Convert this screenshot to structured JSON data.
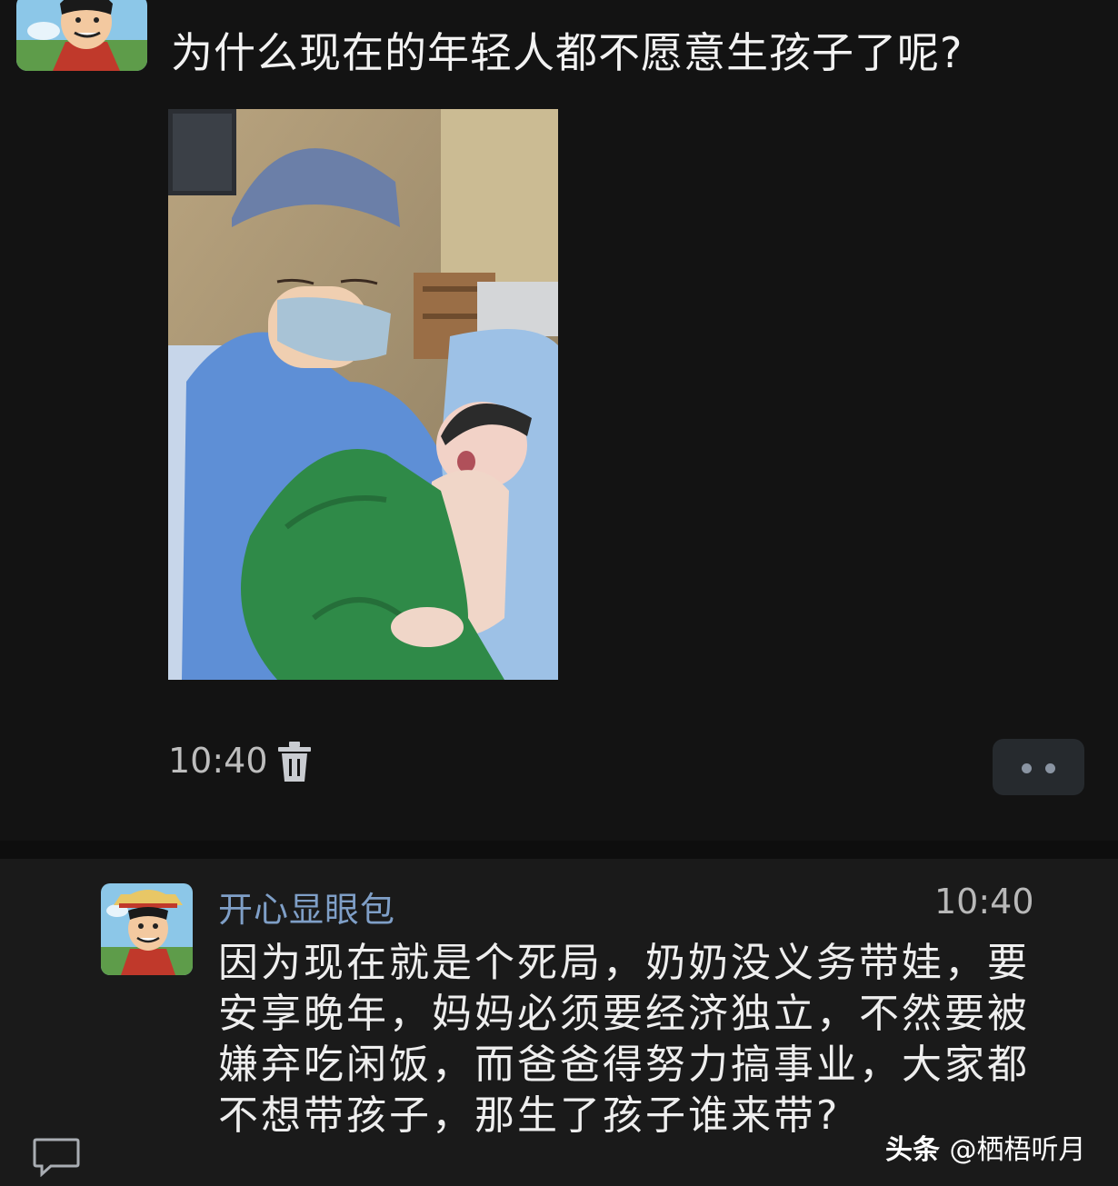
{
  "post": {
    "title": "为什么现在的年轻人都不愿意生孩子了呢?",
    "time": "10:40",
    "avatar_icon": "luffy-avatar",
    "photo_icon": "nurse-holding-newborn-photo"
  },
  "comment": {
    "author": "开心显眼包",
    "time": "10:40",
    "lines": [
      "因为现在就是个死局，奶奶没义务带娃，要",
      "安享晚年，妈妈必须要经济独立，不然要被",
      "嫌弃吃闲饭，而爸爸得努力搞事业，大家都",
      "不想带孩子，那生了孩子谁来带?"
    ]
  },
  "watermark": {
    "brand": "头条",
    "handle": "@栖梧听月"
  },
  "colors": {
    "background": "#121212",
    "name_blue": "#7f9fc7",
    "comment_bg": "#1a1a1a"
  }
}
